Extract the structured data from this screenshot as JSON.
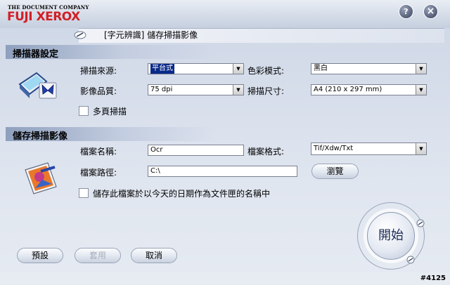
{
  "header": {
    "logo_top": "THE DOCUMENT COMPANY",
    "logo_main": "FUJI XEROX",
    "help_label": "?",
    "close_label": "×",
    "title": "[字元辨識] 儲存掃描影像"
  },
  "scanner_settings": {
    "title": "掃描器設定",
    "source_label": "掃描來源:",
    "source_value": "平台式",
    "color_label": "色彩模式:",
    "color_value": "黑白",
    "quality_label": "影像品質:",
    "quality_value": "75 dpi",
    "size_label": "掃描尺寸:",
    "size_value": "A4 (210 x 297 mm)",
    "multipage_label": "多頁掃描"
  },
  "save_settings": {
    "title": "儲存掃描影像",
    "filename_label": "檔案名稱:",
    "filename_value": "Ocr",
    "format_label": "檔案格式:",
    "format_value": "Tif/Xdw/Txt",
    "path_label": "檔案路徑:",
    "path_value": "C:\\",
    "browse_label": "瀏覽",
    "date_folder_label": "儲存此檔案於以今天的日期作為文件匣的名稱中"
  },
  "footer": {
    "default_label": "預設",
    "apply_label": "套用",
    "cancel_label": "取消",
    "start_label": "開始",
    "id_label": "#4125"
  },
  "colors": {
    "logo_red": "#d21f26",
    "selection_blue": "#0a2a8a",
    "panel_blue": "#cdd6e6"
  }
}
